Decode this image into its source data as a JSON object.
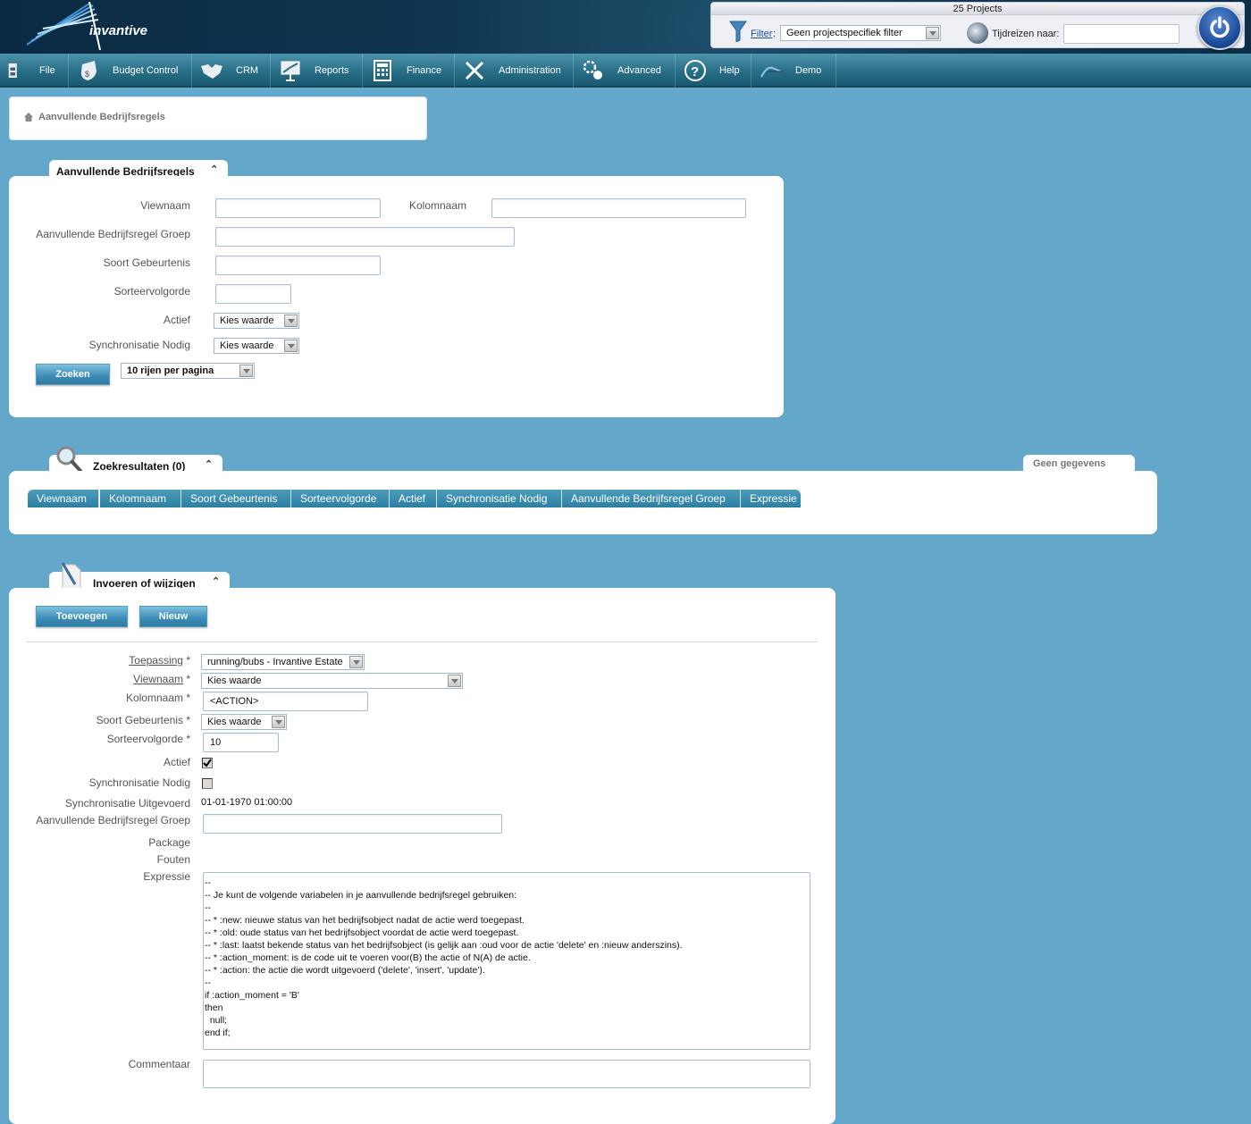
{
  "header": {
    "logo_text": "invantive",
    "projects_title": "25 Projects",
    "filter_link": "Filter",
    "filter_colon": ":",
    "filter_value": "Geen projectspecifiek filter",
    "timetravel_label": "Tijdreizen naar:",
    "timetravel_value": ""
  },
  "nav": {
    "items": [
      {
        "label": "File",
        "icon": "file-cabinet-icon"
      },
      {
        "label": "Budget Control",
        "icon": "money-bag-icon"
      },
      {
        "label": "CRM",
        "icon": "handshake-icon"
      },
      {
        "label": "Reports",
        "icon": "presentation-chart-icon"
      },
      {
        "label": "Finance",
        "icon": "calculator-icon"
      },
      {
        "label": "Administration",
        "icon": "tools-icon"
      },
      {
        "label": "Advanced",
        "icon": "gears-icon"
      },
      {
        "label": "Help",
        "icon": "help-icon"
      },
      {
        "label": "Demo",
        "icon": "demo-icon"
      }
    ]
  },
  "breadcrumb": {
    "label": "Aanvullende Bedrijfsregels"
  },
  "search_panel": {
    "tab_title": "Aanvullende Bedrijfsregels",
    "fields": {
      "viewnaam": "Viewnaam",
      "kolomnaam": "Kolomnaam",
      "groep": "Aanvullende Bedrijfsregel Groep",
      "soort": "Soort Gebeurtenis",
      "sorteer": "Sorteervolgorde",
      "actief": "Actief",
      "sync": "Synchronisatie Nodig"
    },
    "actief_value": "Kies waarde",
    "sync_value": "Kies waarde",
    "search_button": "Zoeken",
    "rows_per_page": "10 rijen per pagina"
  },
  "results_panel": {
    "tab_title": "Zoekresultaten (0)",
    "no_data": "Geen gegevens",
    "columns": [
      "Viewnaam",
      "Kolomnaam",
      "Soort Gebeurtenis",
      "Sorteervolgorde",
      "Actief",
      "Synchronisatie Nodig",
      "Aanvullende Bedrijfsregel Groep",
      "Expressie"
    ]
  },
  "edit_panel": {
    "tab_title": "Invoeren of wijzigen",
    "add_button": "Toevoegen",
    "new_button": "Nieuw",
    "labels": {
      "toepassing": "Toepassing",
      "viewnaam": "Viewnaam",
      "kolomnaam": "Kolomnaam *",
      "soort": "Soort Gebeurtenis *",
      "sorteer": "Sorteervolgorde *",
      "actief": "Actief",
      "sync_nodig": "Synchronisatie Nodig",
      "sync_uitgevoerd": "Synchronisatie Uitgevoerd",
      "groep": "Aanvullende Bedrijfsregel Groep",
      "package": "Package",
      "fouten": "Fouten",
      "expressie": "Expressie",
      "commentaar": "Commentaar",
      "required": "*"
    },
    "values": {
      "toepassing": "running/bubs - Invantive Estate",
      "viewnaam": "Kies waarde",
      "kolomnaam": "<ACTION>",
      "soort": "Kies waarde",
      "sorteer": "10",
      "actief": true,
      "sync_nodig": false,
      "sync_uitgevoerd": "01-01-1970 01:00:00",
      "groep": "",
      "expressie": "--\n-- Je kunt de volgende variabelen in je aanvullende bedrijfsregel gebruiken:\n--\n-- * :new: nieuwe status van het bedrijfsobject nadat de actie werd toegepast.\n-- * :old: oude status van het bedrijfsobject voordat de actie werd toegepast.\n-- * :last: laatst bekende status van het bedrijfsobject (is gelijk aan :oud voor de actie 'delete' en :nieuw anderszins).\n-- * :action_moment: is de code uit te voeren voor(B) the actie of N(A) de actie.\n-- * :action: the actie die wordt uitgevoerd ('delete', 'insert', 'update').\n--\nif :action_moment = 'B'\nthen\n  null;\nend if;",
      "commentaar": ""
    }
  },
  "colors": {
    "background": "#63a8cb",
    "nav": "#2a7189",
    "accent": "#3c8cb6"
  }
}
